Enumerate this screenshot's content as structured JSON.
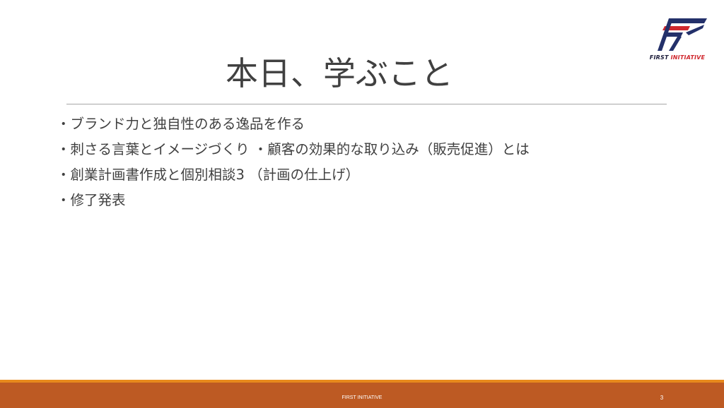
{
  "logo": {
    "word1": "FIRST",
    "word2": "INITIATIVE",
    "colors": {
      "navy": "#23306a",
      "red": "#d0282e"
    }
  },
  "slide": {
    "title": "本日、学ぶこと",
    "bullets": [
      "・ブランド力と独自性のある逸品を作る",
      "・刺さる言葉とイメージづくり ・顧客の効果的な取り込み（販売促進）とは",
      "・創業計画書作成と個別相談3 （計画の仕上げ）",
      "・修了発表"
    ]
  },
  "footer": {
    "text": "FIRST INITIATIVE",
    "page_number": "3",
    "colors": {
      "bar": "#bd5a23",
      "accent": "#e8891c"
    }
  }
}
